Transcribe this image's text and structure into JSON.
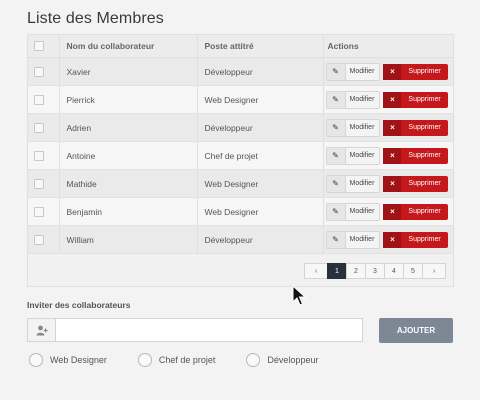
{
  "page": {
    "title": "Liste des Membres"
  },
  "table": {
    "headers": {
      "name": "Nom du collaborateur",
      "role": "Poste attitré",
      "actions": "Actions"
    },
    "edit_label": "Modifier",
    "delete_label": "Supprimer",
    "rows": [
      {
        "name": "Xavier",
        "role": "Développeur"
      },
      {
        "name": "Pierrick",
        "role": "Web Designer"
      },
      {
        "name": "Adrien",
        "role": "Développeur"
      },
      {
        "name": "Antoine",
        "role": "Chef de projet"
      },
      {
        "name": "Mathide",
        "role": "Web Designer"
      },
      {
        "name": "Benjamin",
        "role": "Web Designer"
      },
      {
        "name": "William",
        "role": "Développeur"
      }
    ]
  },
  "pagination": {
    "prev": "‹",
    "next": "›",
    "pages": [
      "1",
      "2",
      "3",
      "4",
      "5"
    ],
    "current": "1"
  },
  "invite": {
    "label": "Inviter des collaborateurs",
    "input_value": "",
    "button_label": "AJOUTER",
    "roles": [
      "Web Designer",
      "Chef de projet",
      "Développeur"
    ]
  },
  "colors": {
    "delete": "#c4181c",
    "active_page": "#28313b",
    "add_button": "#7e8796"
  },
  "icons": {
    "edit": "pencil-icon",
    "delete": "x-icon",
    "invite": "add-user-icon"
  }
}
